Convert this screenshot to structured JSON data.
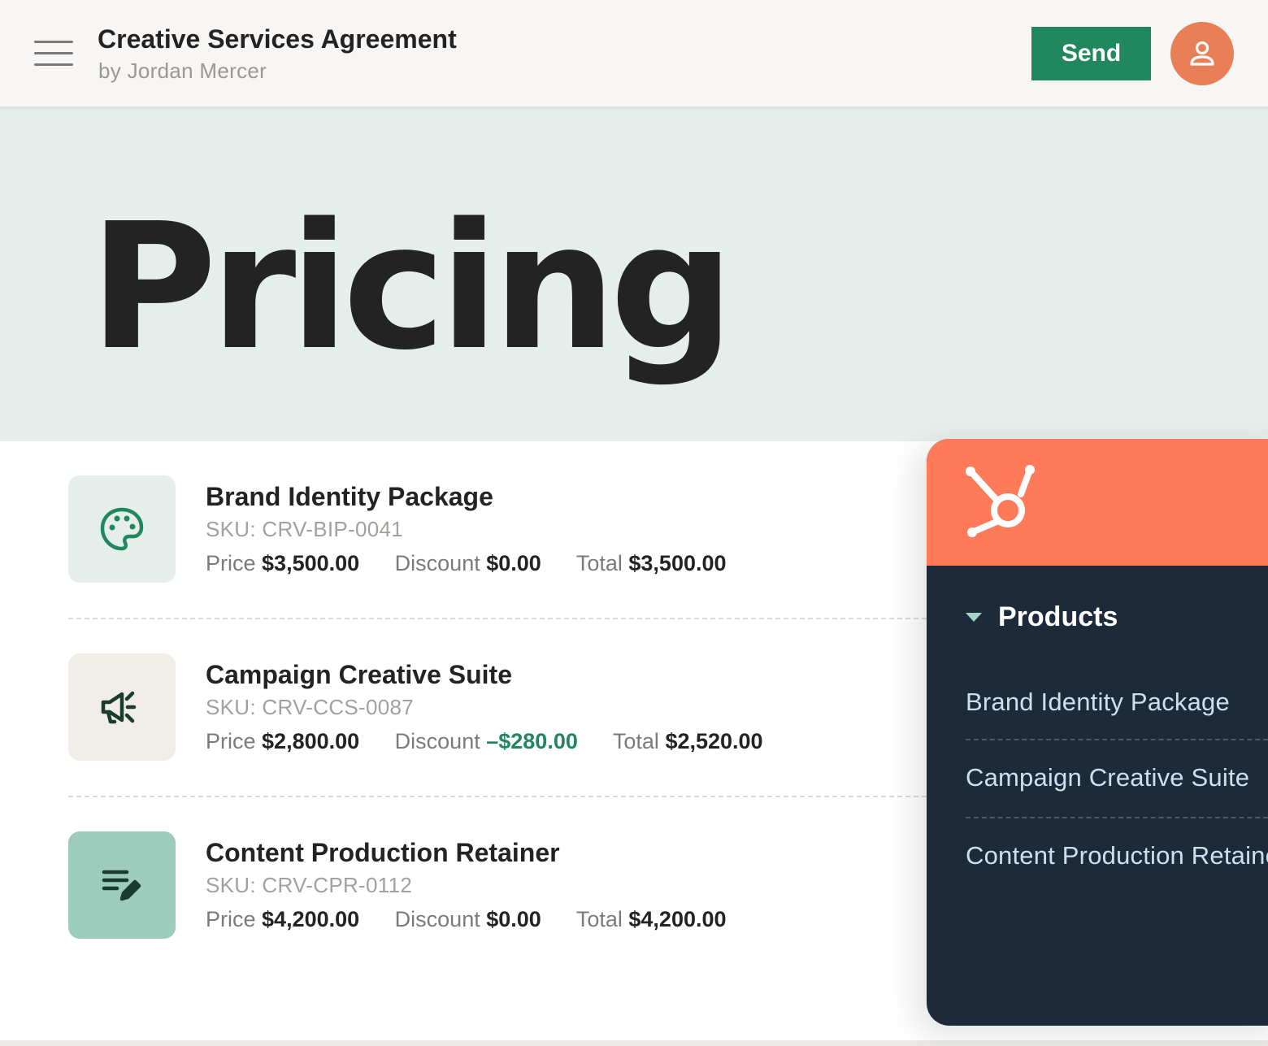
{
  "header": {
    "title": "Creative Services Agreement",
    "author": "by Jordan Mercer",
    "send_label": "Send"
  },
  "hero": {
    "title": "Pricing"
  },
  "products": [
    {
      "name": "Brand Identity Package",
      "sku": "SKU: CRV-BIP-0041",
      "price_label": "Price",
      "price": "$3,500.00",
      "discount_label": "Discount",
      "discount": "$0.00",
      "total_label": "Total",
      "total": "$3,500.00",
      "icon": "palette-icon"
    },
    {
      "name": "Campaign Creative Suite",
      "sku": "SKU: CRV-CCS-0087",
      "price_label": "Price",
      "price": "$2,800.00",
      "discount_label": "Discount",
      "discount": "–$280.00",
      "total_label": "Total",
      "total": "$2,520.00",
      "icon": "megaphone-icon"
    },
    {
      "name": "Content Production Retainer",
      "sku": "SKU: CRV-CPR-0112",
      "price_label": "Price",
      "price": "$4,200.00",
      "discount_label": "Discount",
      "discount": "$0.00",
      "total_label": "Total",
      "total": "$4,200.00",
      "icon": "edit-list-icon"
    }
  ],
  "side_panel": {
    "logo": "hubspot-sprocket-icon",
    "section_label": "Products",
    "items": [
      "Brand Identity Package",
      "Campaign Creative Suite",
      "Content Production Retainer"
    ]
  },
  "colors": {
    "accent_green": "#21875f",
    "avatar_orange": "#e87f57",
    "panel_orange": "#ff7a59",
    "panel_navy": "#1c2a3a",
    "hero_bg": "#e6eeec"
  }
}
